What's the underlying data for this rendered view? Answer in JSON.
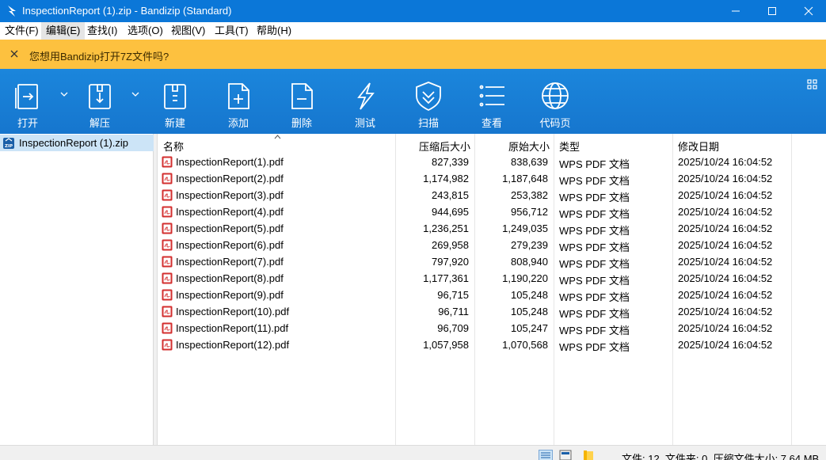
{
  "window": {
    "title": "InspectionReport (1).zip - Bandizip (Standard)"
  },
  "menu": [
    "文件(F)",
    "编辑(E)",
    "查找(I)",
    "选项(O)",
    "视图(V)",
    "工具(T)",
    "帮助(H)"
  ],
  "notice": {
    "message": "您想用Bandizip打开7Z文件吗?"
  },
  "toolbar": {
    "open": "打开",
    "extract": "解压",
    "new": "新建",
    "add": "添加",
    "delete": "删除",
    "test": "测试",
    "scan": "扫描",
    "view": "查看",
    "codepage": "代码页"
  },
  "tree": {
    "archive": "InspectionReport (1).zip"
  },
  "columns": {
    "name": "名称",
    "compressed": "压缩后大小",
    "original": "原始大小",
    "type": "类型",
    "modified": "修改日期"
  },
  "files": [
    {
      "name": "InspectionReport(1).pdf",
      "compressed": "827,339",
      "original": "838,639",
      "type": "WPS PDF 文档",
      "modified": "2025/10/24 16:04:52"
    },
    {
      "name": "InspectionReport(2).pdf",
      "compressed": "1,174,982",
      "original": "1,187,648",
      "type": "WPS PDF 文档",
      "modified": "2025/10/24 16:04:52"
    },
    {
      "name": "InspectionReport(3).pdf",
      "compressed": "243,815",
      "original": "253,382",
      "type": "WPS PDF 文档",
      "modified": "2025/10/24 16:04:52"
    },
    {
      "name": "InspectionReport(4).pdf",
      "compressed": "944,695",
      "original": "956,712",
      "type": "WPS PDF 文档",
      "modified": "2025/10/24 16:04:52"
    },
    {
      "name": "InspectionReport(5).pdf",
      "compressed": "1,236,251",
      "original": "1,249,035",
      "type": "WPS PDF 文档",
      "modified": "2025/10/24 16:04:52"
    },
    {
      "name": "InspectionReport(6).pdf",
      "compressed": "269,958",
      "original": "279,239",
      "type": "WPS PDF 文档",
      "modified": "2025/10/24 16:04:52"
    },
    {
      "name": "InspectionReport(7).pdf",
      "compressed": "797,920",
      "original": "808,940",
      "type": "WPS PDF 文档",
      "modified": "2025/10/24 16:04:52"
    },
    {
      "name": "InspectionReport(8).pdf",
      "compressed": "1,177,361",
      "original": "1,190,220",
      "type": "WPS PDF 文档",
      "modified": "2025/10/24 16:04:52"
    },
    {
      "name": "InspectionReport(9).pdf",
      "compressed": "96,715",
      "original": "105,248",
      "type": "WPS PDF 文档",
      "modified": "2025/10/24 16:04:52"
    },
    {
      "name": "InspectionReport(10).pdf",
      "compressed": "96,711",
      "original": "105,248",
      "type": "WPS PDF 文档",
      "modified": "2025/10/24 16:04:52"
    },
    {
      "name": "InspectionReport(11).pdf",
      "compressed": "96,709",
      "original": "105,247",
      "type": "WPS PDF 文档",
      "modified": "2025/10/24 16:04:52"
    },
    {
      "name": "InspectionReport(12).pdf",
      "compressed": "1,057,958",
      "original": "1,070,568",
      "type": "WPS PDF 文档",
      "modified": "2025/10/24 16:04:52"
    }
  ],
  "status": {
    "summary": "文件: 12, 文件夹: 0, 压缩文件大小: 7.64 MB"
  },
  "icons": {
    "app": "bandizip-logo-icon",
    "minimize": "minimize-icon",
    "maximize": "maximize-icon",
    "close": "close-icon",
    "notice_close": "close-icon",
    "open": "open-archive-icon",
    "extract": "extract-archive-icon",
    "new": "new-archive-icon",
    "add": "add-file-icon",
    "delete": "delete-file-icon",
    "test": "lightning-icon",
    "scan": "shield-icon",
    "view": "list-icon",
    "codepage": "globe-icon",
    "layout": "grid-icon",
    "archive": "zip-file-icon",
    "file": "pdf-file-icon",
    "details_view": "details-view-icon",
    "list_view": "list-view-icon",
    "folder": "folder-icon"
  },
  "colors": {
    "titlebar": "#0b77d8",
    "notice": "#fdc13f",
    "toolbar": "#1878d2",
    "selection": "#cce4f7",
    "pdf": "#d32f2f"
  }
}
